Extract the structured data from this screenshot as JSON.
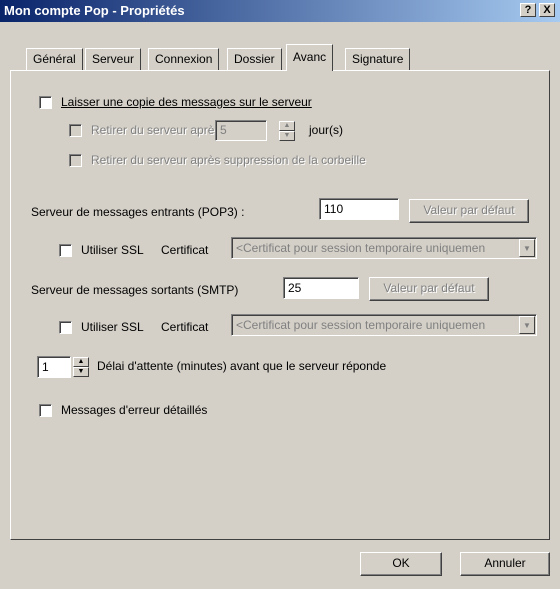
{
  "window": {
    "title": "Mon compte Pop - Propriétés",
    "help_label": "?",
    "close_label": "X"
  },
  "tabs": [
    {
      "label": "Général"
    },
    {
      "label": "Serveur"
    },
    {
      "label": "Connexion"
    },
    {
      "label": "Dossier"
    },
    {
      "label": "Avanc"
    },
    {
      "label": "Signature"
    }
  ],
  "active_tab": "Avanc",
  "copy": {
    "keep_copy_label": "Laisser une copie des messages sur le serveur",
    "keep_copy_checked": false,
    "remove_after_label": "Retirer du serveur après",
    "remove_after_days": "5",
    "days_unit": "jour(s)",
    "remove_after_delete_label": "Retirer du serveur après suppression de la corbeille"
  },
  "pop3": {
    "label": "Serveur de messages entrants (POP3) :",
    "port": "110",
    "default_button": "Valeur par défaut",
    "ssl_label": "Utiliser SSL",
    "cert_label": "Certificat",
    "cert_value": "<Certificat pour session temporaire uniquemen"
  },
  "smtp": {
    "label": "Serveur de messages sortants (SMTP)",
    "port": "25",
    "default_button": "Valeur par défaut",
    "ssl_label": "Utiliser SSL",
    "cert_label": "Certificat",
    "cert_value": "<Certificat pour session temporaire uniquemen"
  },
  "timeout": {
    "value": "1",
    "label": "Délai d'attente (minutes) avant que le serveur réponde"
  },
  "errors": {
    "label": "Messages d'erreur détaillés",
    "checked": false
  },
  "footer": {
    "ok_label": "OK",
    "cancel_label": "Annuler"
  }
}
